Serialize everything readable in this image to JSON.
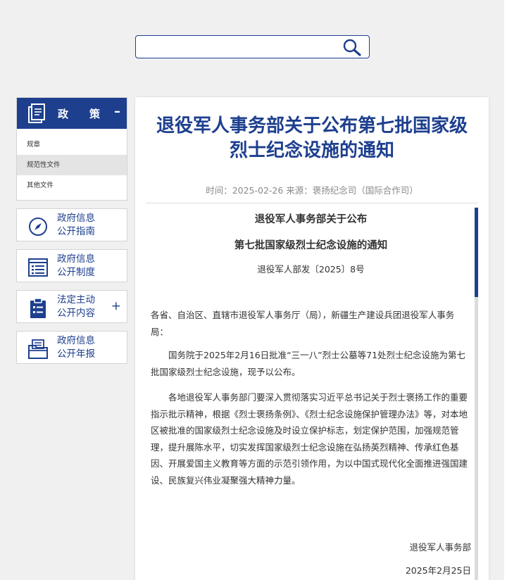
{
  "search": {
    "placeholder": "",
    "value": ""
  },
  "icons": {
    "search": "magnifier-icon",
    "policy": "document-icon",
    "guide": "compass-icon",
    "system": "list-icon",
    "content": "clipboard-icon",
    "report": "folder-icon"
  },
  "colors": {
    "brand": "#1d3f8e",
    "active_bg": "#e4e4e4"
  },
  "sidebar": {
    "policy": {
      "title": "政策",
      "toggle": "–",
      "items": [
        {
          "label": "规章"
        },
        {
          "label": "规范性文件"
        },
        {
          "label": "其他文件"
        }
      ]
    },
    "cards": [
      {
        "line1": "政府信息",
        "line2": "公开指南"
      },
      {
        "line1": "政府信息",
        "line2": "公开制度"
      },
      {
        "line1": "法定主动",
        "line2": "公开内容",
        "toggle": "+"
      },
      {
        "line1": "政府信息",
        "line2": "公开年报"
      }
    ]
  },
  "article": {
    "title": "退役军人事务部关于公布第七批国家级烈士纪念设施的通知",
    "meta": "时间：2025-02-26   来源：褒扬纪念司（国际合作司）",
    "doc_title_1": "退役军人事务部关于公布",
    "doc_title_2": "第七批国家级烈士纪念设施的通知",
    "doc_number": "退役军人部发〔2025〕8号",
    "para1": "各省、自治区、直辖市退役军人事务厅（局），新疆生产建设兵团退役军人事务局：",
    "para2": "国务院于2025年2月16日批准“三一八”烈士公墓等71处烈士纪念设施为第七批国家级烈士纪念设施，现予以公布。",
    "para3": "各地退役军人事务部门要深入贯彻落实习近平总书记关于烈士褒扬工作的重要指示批示精神，根据《烈士褒扬条例》、《烈士纪念设施保护管理办法》等，对本地区被批准的国家级烈士纪念设施及时设立保护标志，划定保护范围，加强规范管理，提升展陈水平，切实发挥国家级烈士纪念设施在弘扬英烈精神、传承红色基因、开展爱国主义教育等方面的示范引领作用，为以中国式现代化全面推进强国建设、民族复兴伟业凝聚强大精神力量。",
    "sign_org": "退役军人事务部",
    "sign_date": "2025年2月25日"
  }
}
